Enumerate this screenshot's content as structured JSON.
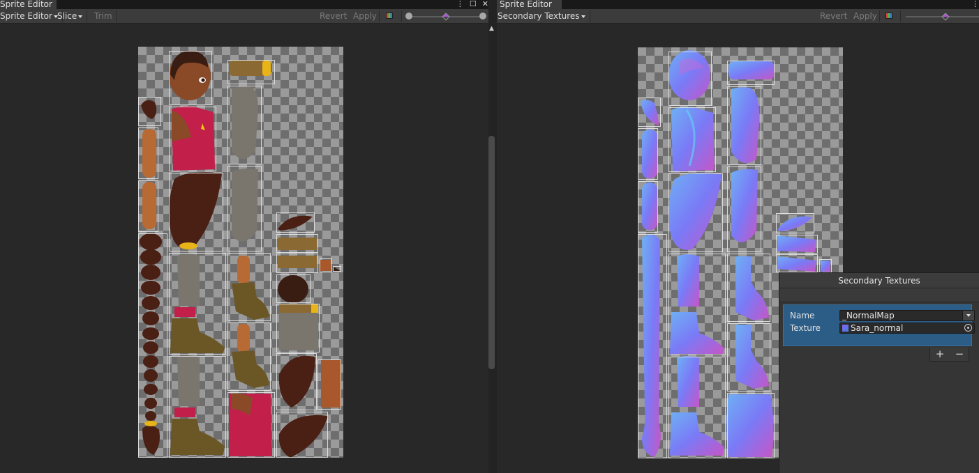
{
  "left": {
    "tab_title": "Sprite Editor",
    "toolbar": {
      "mode_label": "Sprite Editor",
      "slice_label": "Slice",
      "trim_label": "Trim",
      "revert_label": "Revert",
      "apply_label": "Apply"
    }
  },
  "right": {
    "tab_title": "Sprite Editor",
    "toolbar": {
      "mode_label": "Secondary Textures",
      "revert_label": "Revert",
      "apply_label": "Apply"
    },
    "panel": {
      "title": "Secondary Textures",
      "name_label": "Name",
      "name_value": "_NormalMap",
      "texture_label": "Texture",
      "texture_value": "Sara_normal",
      "add_label": "+",
      "remove_label": "−"
    }
  },
  "colors": {
    "diffuse_skin": "#b86a35",
    "diffuse_hair": "#4a2016",
    "diffuse_shirt": "#c0204a",
    "normal_map": "#7a7af0"
  }
}
